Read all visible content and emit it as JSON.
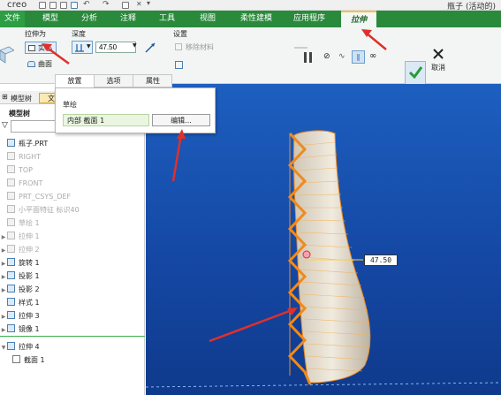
{
  "titlebar": {
    "app": "creo",
    "window_title": "瓶子 (活动的)"
  },
  "tabs": [
    {
      "label": "文件"
    },
    {
      "label": "模型"
    },
    {
      "label": "分析"
    },
    {
      "label": "注释"
    },
    {
      "label": "工具"
    },
    {
      "label": "视图"
    },
    {
      "label": "柔性建模"
    },
    {
      "label": "应用程序"
    },
    {
      "label": "拉伸"
    }
  ],
  "ribbon": {
    "extrude_as": "拉伸为",
    "solid": "实心",
    "surface": "曲面",
    "depth": "深度",
    "depth_value": "47.50",
    "settings": "设置",
    "remove_material": "移除材料",
    "ok": "确定",
    "cancel": "取消"
  },
  "panel": {
    "tabs": [
      {
        "label": "放置"
      },
      {
        "label": "选项"
      },
      {
        "label": "属性"
      }
    ],
    "sketch_label": "草绘",
    "sketch_value": "内部 截面 1",
    "edit": "编辑..."
  },
  "left": {
    "tab_model_tree": "模型树",
    "tab_folder": "文",
    "section_title": "模型树",
    "items": [
      {
        "label": "瓶子.PRT",
        "faded": false,
        "arrow": ""
      },
      {
        "label": "RIGHT",
        "faded": true,
        "arrow": ""
      },
      {
        "label": "TOP",
        "faded": true,
        "arrow": ""
      },
      {
        "label": "FRONT",
        "faded": true,
        "arrow": ""
      },
      {
        "label": "PRT_CSYS_DEF",
        "faded": true,
        "arrow": ""
      },
      {
        "label": "小平面特征 标识40",
        "faded": true,
        "arrow": ""
      },
      {
        "label": "草绘 1",
        "faded": true,
        "arrow": ""
      },
      {
        "label": "拉伸 1",
        "faded": true,
        "arrow": "▶"
      },
      {
        "label": "拉伸 2",
        "faded": true,
        "arrow": "▶"
      },
      {
        "label": "旋转 1",
        "faded": false,
        "arrow": "▶"
      },
      {
        "label": "投影 1",
        "faded": false,
        "arrow": "▶"
      },
      {
        "label": "投影 2",
        "faded": false,
        "arrow": "▶"
      },
      {
        "label": "样式 1",
        "faded": false,
        "arrow": ""
      },
      {
        "label": "拉伸 3",
        "faded": false,
        "arrow": "▶"
      },
      {
        "label": "镜像 1",
        "faded": false,
        "arrow": "▶"
      }
    ],
    "active_item": "拉伸 4",
    "active_child": "截面 1"
  },
  "viewport": {
    "dimension": "47.50"
  },
  "colors": {
    "ribbon_green": "#2a8a3b",
    "annotation_red": "#e0302a",
    "viewport_blue": "#1a55b5",
    "sketch_orange": "#f08a1c"
  }
}
